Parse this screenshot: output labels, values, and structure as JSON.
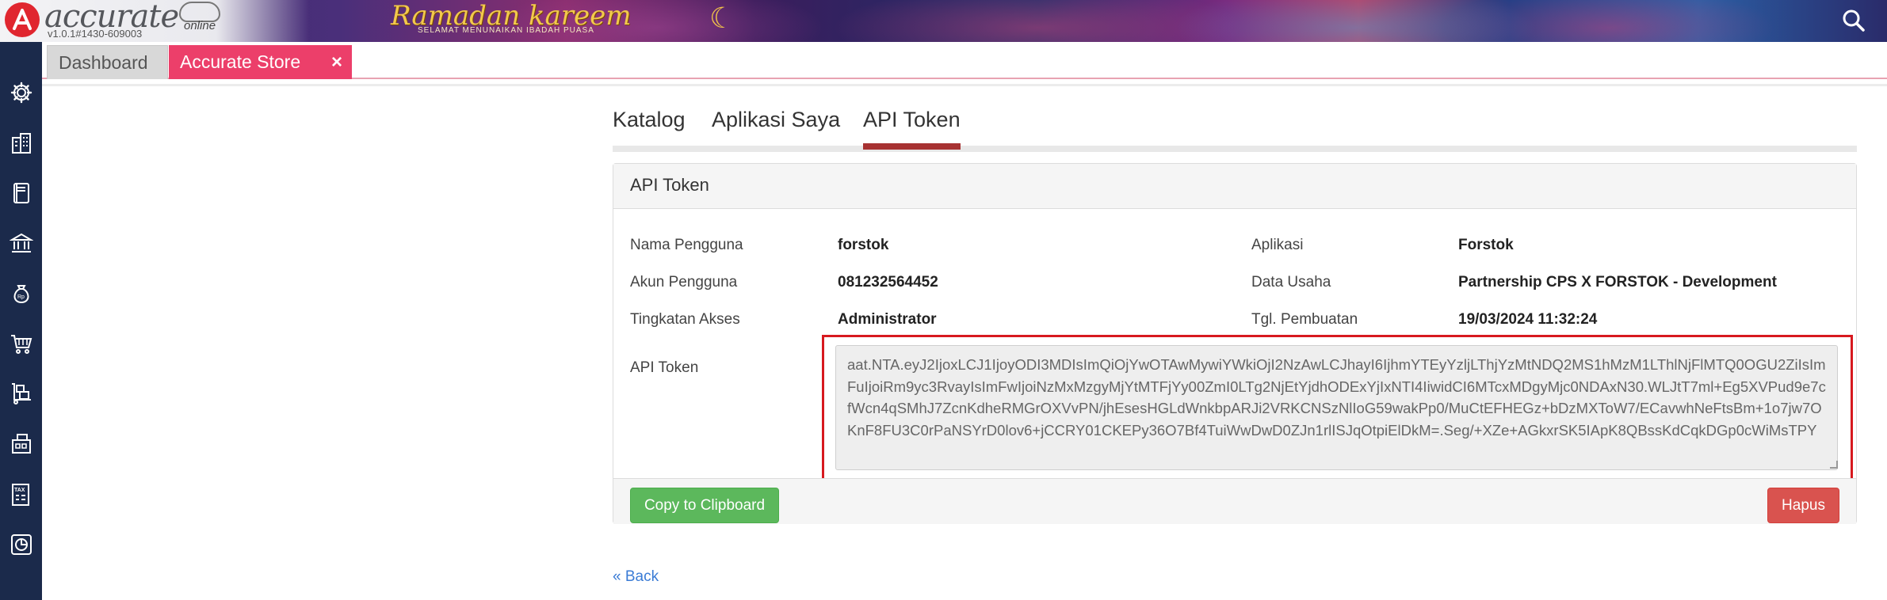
{
  "app": {
    "logo_text": "accurate",
    "logo_sub": "online",
    "version": "v1.0.1#1430-609003",
    "banner_title": "Ramadan kareem",
    "banner_subtitle": "SELAMAT MENUNAIKAN IBADAH PUASA"
  },
  "tabs": [
    {
      "label": "Dashboard"
    },
    {
      "label": "Accurate Store",
      "close": "×"
    }
  ],
  "sidebar_icons": [
    "gear-icon",
    "building-icon",
    "book-icon",
    "bank-icon",
    "money-bag-icon",
    "cart-icon",
    "delivery-icon",
    "warehouse-icon",
    "tax-icon",
    "report-icon"
  ],
  "nav": {
    "items": [
      "Katalog",
      "Aplikasi Saya",
      "API Token"
    ],
    "active": "API Token"
  },
  "panel": {
    "title": "API Token",
    "fields": {
      "nama_pengguna_label": "Nama Pengguna",
      "nama_pengguna": "forstok",
      "akun_pengguna_label": "Akun Pengguna",
      "akun_pengguna": "081232564452",
      "tingkatan_akses_label": "Tingkatan Akses",
      "tingkatan_akses": "Administrator",
      "aplikasi_label": "Aplikasi",
      "aplikasi": "Forstok",
      "data_usaha_label": "Data Usaha",
      "data_usaha": "Partnership CPS X FORSTOK - Development",
      "tgl_pembuatan_label": "Tgl. Pembuatan",
      "tgl_pembuatan": "19/03/2024 11:32:24",
      "api_token_label": "API Token",
      "api_token": "aat.NTA.eyJ2IjoxLCJ1IjoyODI3MDIsImQiOjYwOTAwMywiYWkiOjI2NzAwLCJhayI6IjhmYTEyYzljLThjYzMtNDQ2MS1hMzM1LThlNjFlMTQ0OGU2ZiIsImFuIjoiRm9yc3RvayIsImFwIjoiNzMxMzgyMjYtMTFjYy00ZmI0LTg2NjEtYjdhODExYjIxNTI4IiwidCI6MTcxMDgyMjc0NDAxN30.WLJtT7ml+Eg5XVPud9e7cfWcn4qSMhJ7ZcnKdheRMGrOXVvPN/jhEsesHGLdWnkbpARJi2VRKCNSzNlIoG59wakPp0/MuCtEFHEGz+bDzMXToW7/ECavwhNeFtsBm+1o7jw7OKnF8FU3C0rPaNSYrD0lov6+jCCRY01CKEPy36O7Bf4TuiWwDwD0ZJn1rlISJqOtpiElDkM=.Seg/+XZe+AGkxrSK5IApK8QBssKdCqkDGp0cWiMsTPY"
    },
    "copy_button": "Copy to Clipboard",
    "delete_button": "Hapus"
  },
  "back_link": "« Back",
  "colors": {
    "accent_tab": "#ec3f6a",
    "active_nav_underline": "#a73232",
    "highlight_box": "#d7191f",
    "copy_button": "#5cb85c",
    "delete_button": "#d9534f",
    "sidebar": "#1b2a4b"
  }
}
